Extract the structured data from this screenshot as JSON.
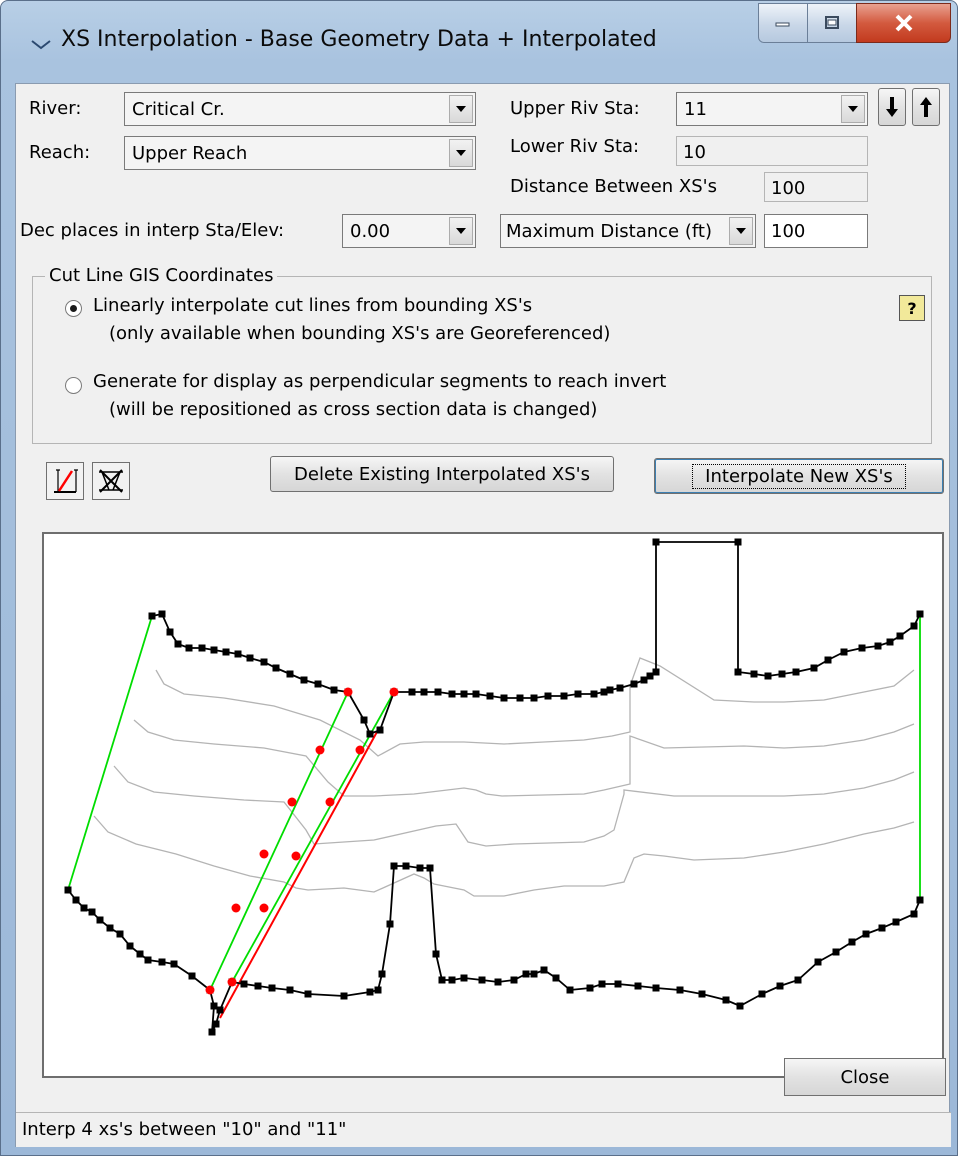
{
  "window": {
    "title": "XS Interpolation  - Base Geometry Data + Interpolated"
  },
  "form": {
    "river_label": "River:",
    "river_value": "Critical Cr.",
    "reach_label": "Reach:",
    "reach_value": "Upper Reach",
    "upper_riv_sta_label": "Upper Riv Sta:",
    "upper_riv_sta_value": "11",
    "lower_riv_sta_label": "Lower Riv Sta:",
    "lower_riv_sta_value": "10",
    "distance_label": "Distance Between XS's",
    "distance_value": "100",
    "dec_places_label": "Dec places in interp Sta/Elev:",
    "dec_places_value": "0.00",
    "max_distance_option": "Maximum Distance (ft)",
    "max_distance_value": "100"
  },
  "cutline_group": {
    "title": "Cut Line GIS Coordinates",
    "option1_line1": "Linearly interpolate cut lines from bounding XS's",
    "option1_line2": "(only available when bounding XS's are Georeferenced)",
    "option2_line1": "Generate for display as perpendicular segments to reach invert",
    "option2_line2": "(will be repositioned as cross section data is changed)",
    "selected_option": 1
  },
  "buttons": {
    "delete": "Delete Existing Interpolated XS's",
    "interpolate": "Interpolate New XS's",
    "close": "Close"
  },
  "status": {
    "text": "Interp 4 xs's between \"10\" and \"11\""
  },
  "icons": {
    "title": "window-menu-icon",
    "down_arrow": "move-down-arrow-icon",
    "up_arrow": "move-up-arrow-icon",
    "help": "help-icon",
    "tool1": "draw-line-tool-icon",
    "tool2": "delete-lines-tool-icon"
  },
  "colors": {
    "xs_line": "#000000",
    "interpolated_xs": "#b4b4b4",
    "bank_marker": "#ff0000",
    "cut_line": "#00dd00",
    "main_channel_line": "#ff0000"
  }
}
